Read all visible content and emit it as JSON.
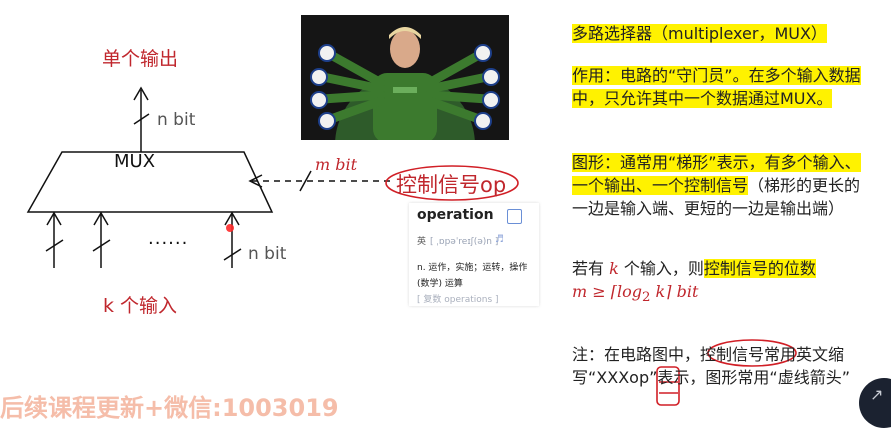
{
  "diagram": {
    "output_title": "单个输出",
    "input_title": "k 个输入",
    "mux_label": "MUX",
    "output_width": "n bit",
    "input_width": "n bit",
    "control_width": "m bit",
    "ellipsis": "......",
    "control_label": "控制信号op"
  },
  "dictionary": {
    "word": "operation",
    "phonetic_prefix": "英",
    "phonetic": "[ ˌɒpəˈreɪʃ(ə)n ]",
    "def_line1": "n. 运作，实施；运转，操作",
    "def_line2": "(数学) 运算",
    "plural": "[ 复数 operations ]"
  },
  "notes": {
    "heading": "多路选择器（multiplexer，MUX）",
    "function_hl": "作用：电路的“守门员”。在多个输入数据中，只允许其中一个数据通过MUX。",
    "shape_hl": "图形：通常用“梯形”表示，有多个输入、一个输出、一个控制信号",
    "shape_rest": "（梯形的更长的一边是输入端、更短的一边是输出端）",
    "k_prefix": "若有",
    "k_var": "k",
    "k_middle": "个输入，则",
    "k_hl": "控制信号的位数",
    "math_m": "m ≥ ⌈log",
    "math_sub": "2",
    "math_k": " k⌉",
    "math_unit": " bit",
    "note": "注：在电路图中，控制信号常用英文缩写“XXXop”表示，图形常用“虚线箭头”"
  },
  "watermark": "后续课程更新+微信:1003019",
  "colors": {
    "accent_red": "#c0272d",
    "highlight_yellow": "#fff200",
    "pen_red": "#d11f26"
  }
}
